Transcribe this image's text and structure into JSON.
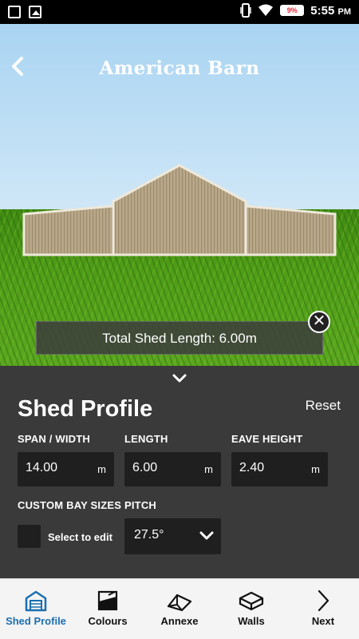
{
  "status_bar": {
    "battery": "9%",
    "time": "5:55",
    "ampm": "PM"
  },
  "header": {
    "title": "American Barn"
  },
  "scene": {
    "total_length_text": "Total Shed Length: 6.00m"
  },
  "panel": {
    "title": "Shed Profile",
    "reset_label": "Reset",
    "span": {
      "label": "SPAN / WIDTH",
      "value": "14.00",
      "unit": "m"
    },
    "length": {
      "label": "LENGTH",
      "value": "6.00",
      "unit": "m"
    },
    "eave": {
      "label": "EAVE HEIGHT",
      "value": "2.40",
      "unit": "m"
    },
    "custom_bay": {
      "label": "CUSTOM BAY SIZES",
      "checkbox_label": "Select to edit"
    },
    "pitch": {
      "label": "PITCH",
      "value": "27.5°"
    }
  },
  "nav": {
    "items": [
      {
        "label": "Shed Profile",
        "icon": "shed-profile-icon",
        "active": true
      },
      {
        "label": "Colours",
        "icon": "colours-icon",
        "active": false
      },
      {
        "label": "Annexe",
        "icon": "annexe-icon",
        "active": false
      },
      {
        "label": "Walls",
        "icon": "walls-icon",
        "active": false
      },
      {
        "label": "Next",
        "icon": "chevron-right-icon",
        "active": false
      }
    ]
  },
  "colors": {
    "accent": "#1a6fb0",
    "panel_bg": "#3a3a3a",
    "field_bg": "#1f1f1f",
    "sky": "#b8dcf4",
    "grass": "#4f9e18"
  }
}
